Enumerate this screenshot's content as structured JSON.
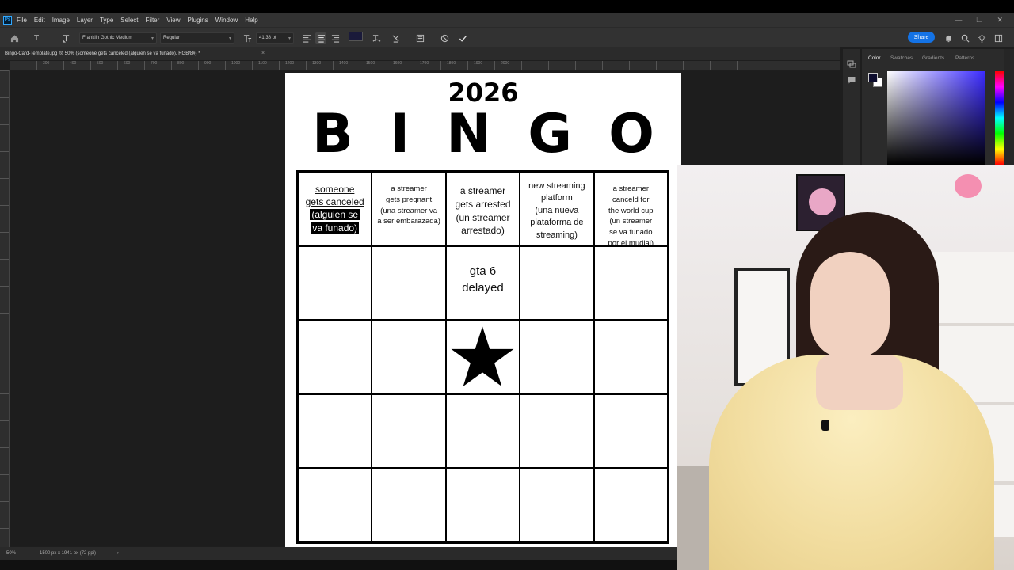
{
  "app": {
    "logo": "Ps",
    "menu": [
      "File",
      "Edit",
      "Image",
      "Layer",
      "Type",
      "Select",
      "Filter",
      "View",
      "Plugins",
      "Window",
      "Help"
    ],
    "window_controls": [
      "—",
      "❐",
      "✕"
    ]
  },
  "options_bar": {
    "font_family": "Franklin Gothic Medium",
    "font_style": "Regular",
    "font_size": "41.38 pt",
    "text_color": "#1a1a3a",
    "share_label": "Share"
  },
  "document": {
    "tab_title": "Bingo-Card-Template.jpg @ 50% (someone gets canceled (alguien se  va funado), RGB/8#) *",
    "close": "×"
  },
  "ruler_labels": [
    "300",
    "400",
    "500",
    "600",
    "700",
    "800",
    "900",
    "1000",
    "1100",
    "1200",
    "1300",
    "1400",
    "1500",
    "1600",
    "1700",
    "1800",
    "1900",
    "2000"
  ],
  "bingo": {
    "year": "2026",
    "letters": [
      "B",
      "I",
      "N",
      "G",
      "O"
    ],
    "cells": {
      "c1_line1": "someone",
      "c1_line2": "gets canceled",
      "c1_sel1": "(alguien se",
      "c1_sel2": "va funado)",
      "c2": [
        "a streamer",
        "gets pregnant",
        "(una streamer va",
        "a ser embarazada)"
      ],
      "c3": [
        "a streamer",
        "gets arrested",
        "(un streamer",
        "arrestado)"
      ],
      "c4": [
        "new streaming",
        "platform",
        "(una nueva",
        "plataforma de",
        "streaming)"
      ],
      "c5": [
        "a streamer",
        "canceld for",
        "the world cup",
        "(un streamer",
        "se va funado",
        "por el mudial)"
      ],
      "gta": [
        "gta 6",
        "delayed"
      ]
    }
  },
  "status_bar": {
    "zoom": "50%",
    "doc_info": "1500 px x 1941 px (72 ppi)",
    "arrow": "›"
  },
  "color_panel": {
    "tabs": [
      "Color",
      "Swatches",
      "Gradients",
      "Patterns"
    ],
    "foreground": "#0d0d2e",
    "background": "#ffffff"
  }
}
